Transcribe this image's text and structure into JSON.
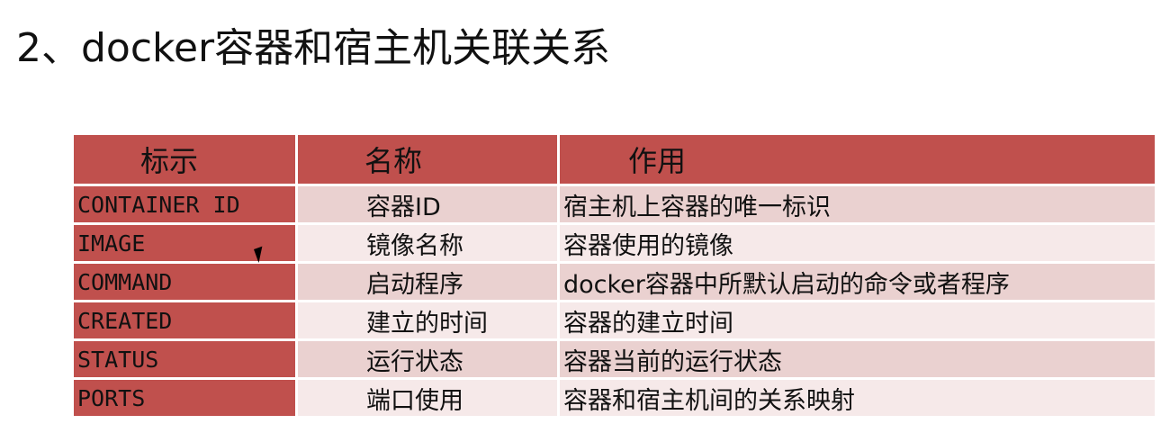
{
  "title": "2、docker容器和宿主机关联关系",
  "table": {
    "headers": [
      "标示",
      "名称",
      "作用"
    ],
    "rows": [
      {
        "key": "CONTAINER ID",
        "name": "容器ID",
        "desc": "宿主机上容器的唯一标识"
      },
      {
        "key": "IMAGE",
        "name": "镜像名称",
        "desc": "容器使用的镜像"
      },
      {
        "key": "COMMAND",
        "name": "启动程序",
        "desc": "docker容器中所默认启动的命令或者程序"
      },
      {
        "key": "CREATED",
        "name": "建立的时间",
        "desc": "容器的建立时间"
      },
      {
        "key": "STATUS",
        "name": "运行状态",
        "desc": "容器当前的运行状态"
      },
      {
        "key": "PORTS",
        "name": "端口使用",
        "desc": "容器和宿主机间的关系映射"
      }
    ]
  },
  "colors": {
    "header_bg": "#c0504d",
    "key_col_bg": "#c0504d",
    "row_band_dark": "#ead1d0",
    "row_band_light": "#f6e9e9"
  }
}
